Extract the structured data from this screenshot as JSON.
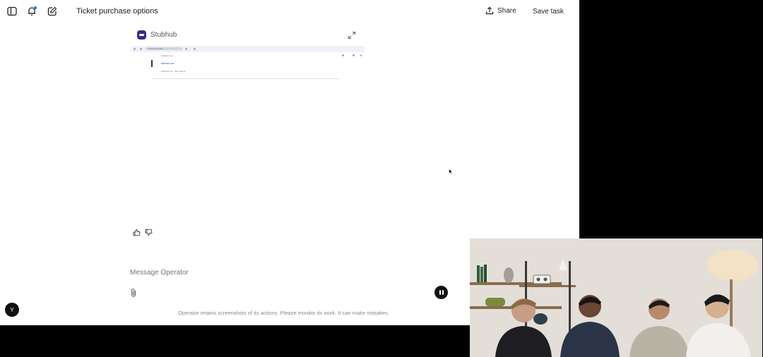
{
  "header": {
    "title": "Ticket purchase options",
    "share_label": "Share",
    "save_label": "Save task"
  },
  "card": {
    "site_name": "Stubhub",
    "mini_screenshot": {
      "tab_text": "Ticket purchase",
      "address_text": "stubhub.com",
      "suggestion_1": "stubhub.com",
      "suggestion_2": "stubhub.com",
      "suggestion_3": "stubhub.com - Buy tickets"
    }
  },
  "composer": {
    "placeholder": "Message Operator"
  },
  "footer": {
    "disclaimer": "Operator retains screenshots of its actions. Please monitor its work. It can make mistakes."
  },
  "user": {
    "avatar_initial": "Y"
  },
  "icons": {
    "sidebar_toggle": "sidebar-icon",
    "notifications": "bell-icon",
    "new_task": "compose-icon",
    "share": "upload-icon",
    "expand": "expand-icon",
    "like": "thumbs-up-icon",
    "dislike": "thumbs-down-icon",
    "attach": "paperclip-icon",
    "pause": "pause-icon"
  },
  "colors": {
    "brand_logo": "#3b2a8a",
    "notification_dot": "#3b82f6",
    "pause_button": "#111111"
  }
}
